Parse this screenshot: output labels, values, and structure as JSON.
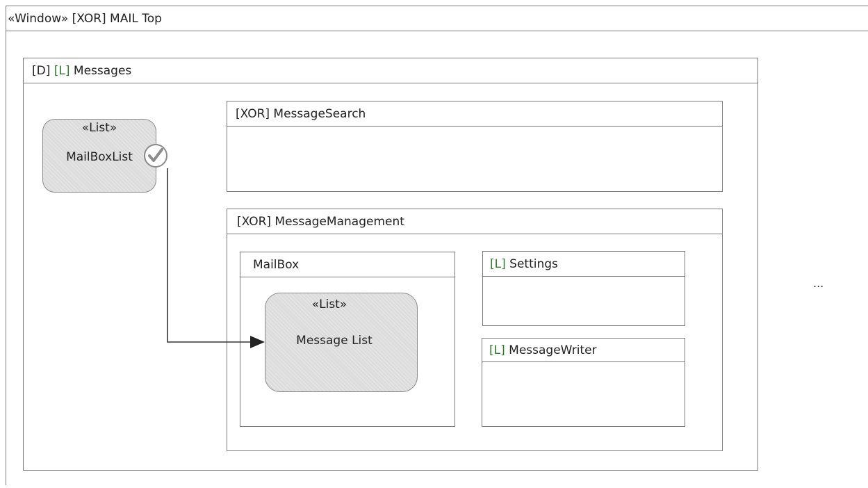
{
  "window": {
    "title": "«Window» [XOR] MAIL Top"
  },
  "messages": {
    "tag_d": "[D] ",
    "tag_l": "[L]",
    "name": " Messages"
  },
  "mailbox_list": {
    "stereotype": "«List»",
    "name": "MailBoxList",
    "status_icon": "checkmark-icon"
  },
  "message_search": {
    "title": "[XOR] MessageSearch"
  },
  "message_management": {
    "title": "[XOR] MessageManagement",
    "mailbox": {
      "title": "MailBox",
      "message_list": {
        "stereotype": "«List»",
        "name": "Message List"
      }
    },
    "settings": {
      "tag_l": "[L]",
      "name": " Settings"
    },
    "message_writer": {
      "tag_l": "[L]",
      "name": " MessageWriter"
    }
  },
  "ellipsis": "...",
  "colors": {
    "border": "#7a7a7a",
    "list_fill": "#dcdcdc",
    "tag_l": "#2b7d2b",
    "arrow": "#333333"
  }
}
